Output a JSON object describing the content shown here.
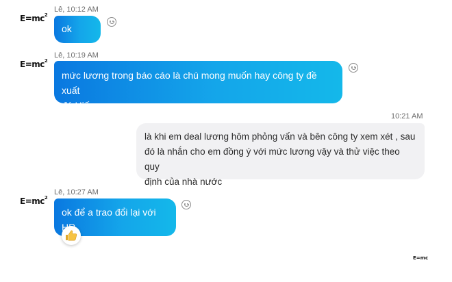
{
  "conversation": {
    "avatar_text": "E=mc",
    "avatar_sup": "2",
    "messages": [
      {
        "sender_time": "Lê, 10:12 AM",
        "text": "ok",
        "direction": "incoming"
      },
      {
        "sender_time": "Lê, 10:19 AM",
        "text_line1": "mức lương trong báo cáo là chú mong muốn hay công ty đề xuất",
        "text_line2": "đó Hiếu",
        "direction": "incoming"
      },
      {
        "time": "10:21 AM",
        "text_line1": "là khi em deal lương hôm phỏng vấn và bên công ty xem xét , sau",
        "text_line2": "đó là nhắn cho em đồng ý với mức lương vậy và thử việc theo quy",
        "text_line3": "định của nhà nước",
        "direction": "outgoing"
      },
      {
        "sender_time": "Lê, 10:27 AM",
        "text": "ok để a trao đổi lại với HR",
        "direction": "incoming",
        "reaction": "thumbs-up"
      }
    ],
    "read_receipt": "E=mc"
  },
  "colors": {
    "incoming_bubble_start": "#0a78e0",
    "incoming_bubble_end": "#14b8ea",
    "outgoing_bubble": "#f1f1f3",
    "thumb_yellow": "#f6c343"
  },
  "icons": {
    "react": "smiley-icon",
    "reaction": "thumbs-up-icon"
  }
}
